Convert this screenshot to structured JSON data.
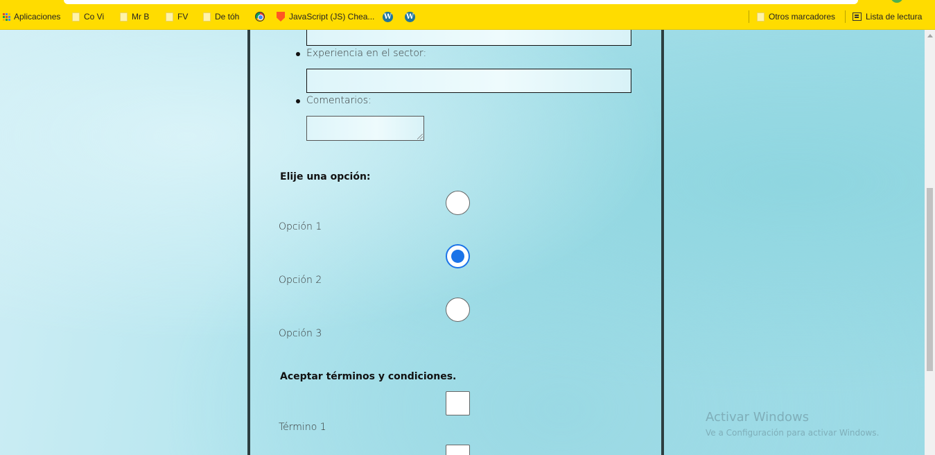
{
  "bookmarks": {
    "apps_label": "Aplicaciones",
    "items": [
      {
        "label": "Co Vi"
      },
      {
        "label": "Mr B"
      },
      {
        "label": "FV"
      },
      {
        "label": "De tóh"
      },
      {
        "label": "JavaScript (JS) Chea..."
      }
    ],
    "other_label": "Otros marcadores",
    "reading_list_label": "Lista de lectura"
  },
  "form": {
    "fields": {
      "experience_label": "Experiencia en el sector:",
      "comments_label": "Comentarios:"
    },
    "options_section": {
      "heading": "Elije una opción:",
      "options": [
        {
          "label": "Opción 1",
          "checked": false
        },
        {
          "label": "Opción 2",
          "checked": true
        },
        {
          "label": "Opción 3",
          "checked": false
        }
      ]
    },
    "terms_section": {
      "heading": "Aceptar términos y condiciones.",
      "terms": [
        {
          "label": "Término 1",
          "checked": false
        }
      ]
    }
  },
  "watermark": {
    "title": "Activar Windows",
    "subtitle": "Ve a Configuración para activar Windows."
  },
  "colors": {
    "bookmarks_bar": "#ffdc00",
    "radio_accent": "#1a73e8",
    "panel_border": "#2c3e40"
  }
}
